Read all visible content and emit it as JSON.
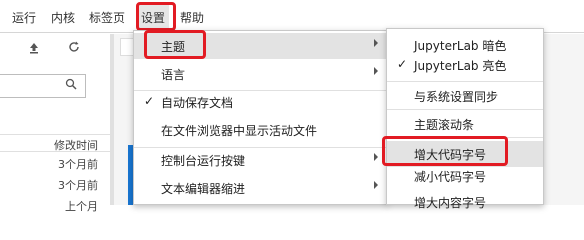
{
  "menubar": {
    "items": [
      "运行",
      "内核",
      "标签页",
      "设置",
      "帮助"
    ],
    "active": "设置"
  },
  "filebrowser": {
    "icons": [
      "upload-icon",
      "refresh-icon",
      "search-icon"
    ],
    "search_placeholder": "",
    "column_header": "修改时间",
    "rows": [
      "3个月前",
      "3个月前",
      "上个月"
    ]
  },
  "settings_menu": {
    "items": [
      {
        "label": "主题",
        "submenu": true
      },
      {
        "label": "语言",
        "submenu": true
      },
      {
        "label": "自动保存文档",
        "checked": true
      },
      {
        "label": "在文件浏览器中显示活动文件"
      },
      {
        "label": "控制台运行按键",
        "submenu": true
      },
      {
        "label": "文本编辑器缩进",
        "submenu": true
      }
    ]
  },
  "theme_submenu": {
    "items": [
      {
        "label": "JupyterLab 暗色"
      },
      {
        "label": "JupyterLab 亮色",
        "checked": true
      },
      {
        "label": "与系统设置同步"
      },
      {
        "label": "主题滚动条"
      },
      {
        "label": "增大代码字号"
      },
      {
        "label": "减小代码字号"
      },
      {
        "label": "增大内容字号"
      }
    ]
  },
  "colors": {
    "highlight": "#e21b23",
    "accent": "#1976d2"
  }
}
